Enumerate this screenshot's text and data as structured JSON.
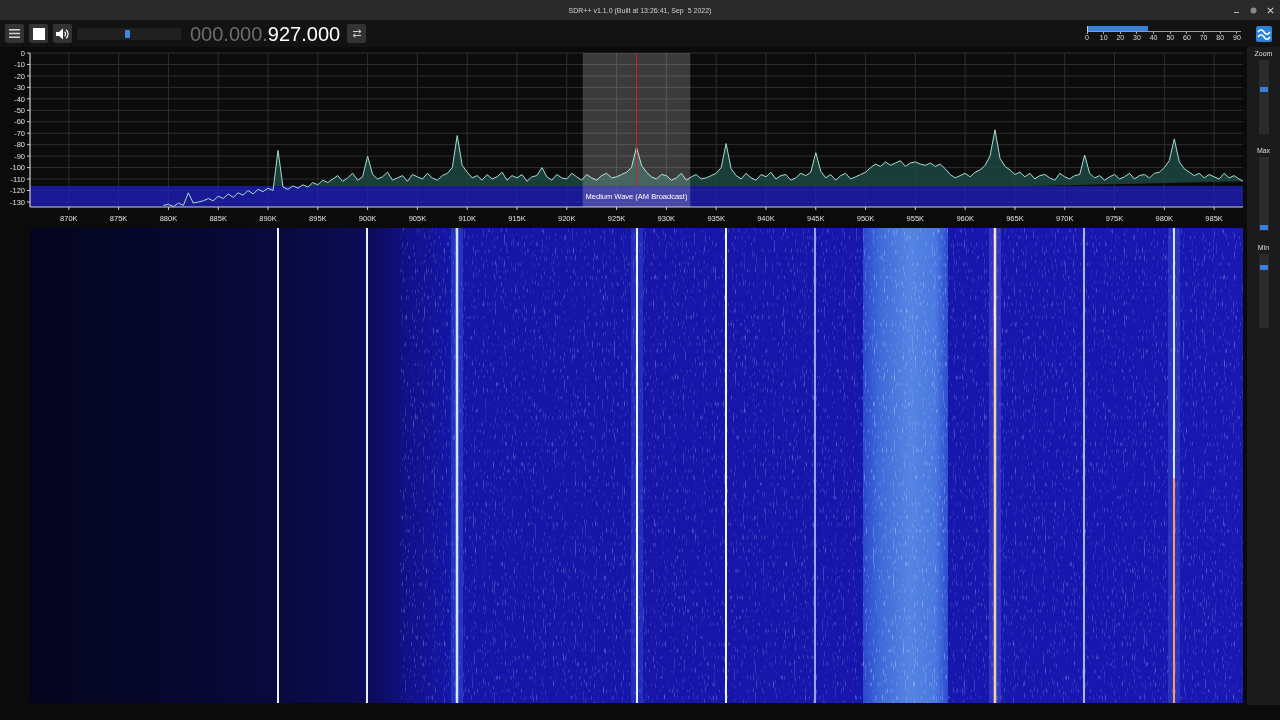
{
  "window": {
    "title": "SDR++ v1.1.0 (Built at 13:26:41, Sep  5 2022)"
  },
  "toolbar": {
    "running": true,
    "volume": {
      "level": 0.48
    },
    "frequency": {
      "leading": "000.000.",
      "value": "927.000"
    },
    "snr_meter": {
      "level": 0.39,
      "scale": [
        "0",
        "10",
        "20",
        "30",
        "40",
        "50",
        "60",
        "70",
        "80",
        "90"
      ]
    }
  },
  "spectrum": {
    "chart_data": {
      "type": "area",
      "grid": true,
      "x": [
        879.5,
        880,
        880.5,
        881,
        881.5,
        882,
        882.5,
        883,
        883.5,
        884,
        884.5,
        885,
        885.5,
        886,
        886.5,
        887,
        887.5,
        888,
        888.5,
        889,
        889.5,
        890,
        890.5,
        891,
        891.5,
        892,
        892.5,
        893,
        893.5,
        894,
        894.5,
        895,
        895.5,
        896,
        896.5,
        897,
        897.5,
        898,
        898.5,
        899,
        899.5,
        900,
        900.5,
        901,
        901.5,
        902,
        902.5,
        903,
        903.5,
        904,
        904.5,
        905,
        905.5,
        906,
        906.5,
        907,
        907.5,
        908,
        908.5,
        909,
        909.5,
        910,
        910.5,
        911,
        911.5,
        912,
        912.5,
        913,
        913.5,
        914,
        914.5,
        915,
        915.5,
        916,
        916.5,
        917,
        917.5,
        918,
        918.5,
        919,
        919.5,
        920,
        920.5,
        921,
        921.5,
        922,
        922.5,
        923,
        923.5,
        924,
        924.5,
        925,
        925.5,
        926,
        926.5,
        927,
        927.5,
        928,
        928.5,
        929,
        929.5,
        930,
        930.5,
        931,
        931.5,
        932,
        932.5,
        933,
        933.5,
        934,
        934.5,
        935,
        935.5,
        936,
        936.5,
        937,
        937.5,
        938,
        938.5,
        939,
        939.5,
        940,
        940.5,
        941,
        941.5,
        942,
        942.5,
        943,
        943.5,
        944,
        944.5,
        945,
        945.5,
        946,
        946.5,
        947,
        947.5,
        948,
        948.5,
        949,
        949.5,
        950,
        950.5,
        951,
        951.5,
        952,
        952.5,
        953,
        953.5,
        954,
        954.5,
        955,
        955.5,
        956,
        956.5,
        957,
        957.5,
        958,
        958.5,
        959,
        959.5,
        960,
        960.5,
        961,
        961.5,
        962,
        962.5,
        963,
        963.5,
        964,
        964.5,
        965,
        965.5,
        966,
        966.5,
        967,
        967.5,
        968,
        968.5,
        969,
        969.5,
        970,
        970.5,
        971,
        971.5,
        972,
        972.5,
        973,
        973.5,
        974,
        974.5,
        975,
        975.5,
        976,
        976.5,
        977,
        977.5,
        978,
        978.5,
        979,
        979.5,
        980,
        980.5,
        981,
        981.5,
        982,
        982.5,
        983,
        983.5,
        984,
        984.5,
        985,
        985.5,
        986,
        986.5,
        987,
        987.5,
        987.9
      ],
      "series": [
        {
          "color": "#a6ddd0",
          "values": [
            -133,
            -132,
            -134,
            -131,
            -133,
            -122,
            -131,
            -130,
            -129,
            -127,
            -129,
            -125,
            -127,
            -123,
            -126,
            -122,
            -124,
            -120,
            -123,
            -119,
            -121,
            -118,
            -120,
            -85,
            -117,
            -119,
            -116,
            -118,
            -115,
            -117,
            -113,
            -115,
            -111,
            -113,
            -110,
            -107,
            -112,
            -109,
            -105,
            -111,
            -108,
            -90,
            -106,
            -110,
            -108,
            -104,
            -111,
            -109,
            -107,
            -112,
            -106,
            -108,
            -110,
            -105,
            -109,
            -111,
            -107,
            -105,
            -100,
            -72,
            -98,
            -104,
            -109,
            -107,
            -111,
            -106,
            -110,
            -108,
            -104,
            -111,
            -107,
            -109,
            -106,
            -112,
            -108,
            -107,
            -100,
            -108,
            -111,
            -106,
            -109,
            -110,
            -105,
            -108,
            -111,
            -106,
            -109,
            -111,
            -107,
            -105,
            -109,
            -108,
            -106,
            -104,
            -100,
            -82,
            -98,
            -104,
            -108,
            -110,
            -106,
            -107,
            -111,
            -109,
            -105,
            -111,
            -108,
            -106,
            -110,
            -109,
            -107,
            -105,
            -100,
            -79,
            -101,
            -107,
            -110,
            -105,
            -109,
            -111,
            -106,
            -108,
            -104,
            -110,
            -107,
            -106,
            -111,
            -109,
            -105,
            -107,
            -104,
            -87,
            -103,
            -109,
            -106,
            -111,
            -107,
            -105,
            -110,
            -108,
            -106,
            -104,
            -100,
            -97,
            -99,
            -95,
            -98,
            -96,
            -94,
            -99,
            -96,
            -95,
            -97,
            -98,
            -96,
            -99,
            -97,
            -101,
            -106,
            -109,
            -107,
            -105,
            -108,
            -104,
            -102,
            -98,
            -90,
            -67,
            -92,
            -99,
            -102,
            -106,
            -104,
            -108,
            -105,
            -110,
            -107,
            -106,
            -109,
            -111,
            -105,
            -108,
            -110,
            -107,
            -106,
            -89,
            -105,
            -109,
            -107,
            -111,
            -108,
            -106,
            -110,
            -108,
            -105,
            -110,
            -107,
            -106,
            -109,
            -105,
            -104,
            -100,
            -94,
            -75,
            -95,
            -101,
            -104,
            -107,
            -105,
            -109,
            -106,
            -108,
            -110,
            -105,
            -109,
            -107,
            -110,
            -112
          ]
        }
      ],
      "xlim": [
        866.1,
        987.9
      ],
      "ylim": [
        -134.4,
        0
      ],
      "xticks": [
        {
          "value": 870,
          "label": "870K"
        },
        {
          "value": 875,
          "label": "875K"
        },
        {
          "value": 880,
          "label": "880K"
        },
        {
          "value": 885,
          "label": "885K"
        },
        {
          "value": 890,
          "label": "890K"
        },
        {
          "value": 895,
          "label": "895K"
        },
        {
          "value": 900,
          "label": "900K"
        },
        {
          "value": 905,
          "label": "905K"
        },
        {
          "value": 910,
          "label": "910K"
        },
        {
          "value": 915,
          "label": "915K"
        },
        {
          "value": 920,
          "label": "920K"
        },
        {
          "value": 925,
          "label": "925K"
        },
        {
          "value": 930,
          "label": "930K"
        },
        {
          "value": 935,
          "label": "935K"
        },
        {
          "value": 940,
          "label": "940K"
        },
        {
          "value": 945,
          "label": "945K"
        },
        {
          "value": 950,
          "label": "950K"
        },
        {
          "value": 955,
          "label": "955K"
        },
        {
          "value": 960,
          "label": "960K"
        },
        {
          "value": 965,
          "label": "965K"
        },
        {
          "value": 970,
          "label": "970K"
        },
        {
          "value": 975,
          "label": "975K"
        },
        {
          "value": 980,
          "label": "980K"
        },
        {
          "value": 985,
          "label": "985K"
        }
      ],
      "yticks": [
        0,
        -10,
        -20,
        -30,
        -40,
        -50,
        -60,
        -70,
        -80,
        -90,
        -100,
        -110,
        -120,
        -130
      ],
      "bands": [
        {
          "axis": "y",
          "from": -134.4,
          "to": -116,
          "color": "#1e1ec8",
          "label": "Medium Wave (AM Broadcast)"
        },
        {
          "axis": "x",
          "from": 921.6,
          "to": 932.4,
          "color": "#ffffff"
        }
      ],
      "ref_lines": [
        {
          "axis": "x",
          "value": 927,
          "color": "#c42424"
        }
      ]
    }
  },
  "side_panel": {
    "sliders": [
      {
        "label": "Zoom",
        "level": 0.61
      },
      {
        "label": "Max",
        "level": 0.02
      },
      {
        "label": "Min",
        "level": 0.84
      }
    ]
  }
}
